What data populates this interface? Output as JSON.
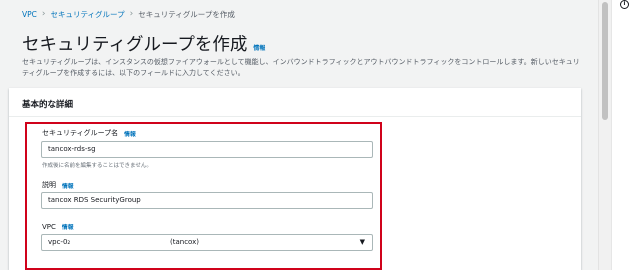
{
  "breadcrumb": {
    "items": [
      "VPC",
      "セキュリティグループ"
    ],
    "separator": "›",
    "current": "セキュリティグループを作成"
  },
  "page": {
    "title": "セキュリティグループを作成",
    "info": "情報",
    "description": "セキュリティグループは、インスタンスの仮想ファイアウォールとして機能し、インバウンドトラフィックとアウトバウンドトラフィックをコントロールします。新しいセキュリティグループを作成するには、以下のフィールドに入力してください。"
  },
  "panel": {
    "title": "基本的な詳細",
    "fields": {
      "name": {
        "label": "セキュリティグループ名",
        "info": "情報",
        "value": "tancox-rds-sg",
        "hint": "作成後に名前を編集することはできません。"
      },
      "description": {
        "label": "説明",
        "info": "情報",
        "value": "tancox RDS SecurityGroup"
      },
      "vpc": {
        "label": "VPC",
        "info": "情報",
        "value_prefix": "vpc-0₂",
        "value_suffix": "(tancox)"
      }
    }
  },
  "icons": {
    "caret": "▼",
    "info_circle": "i"
  },
  "colors": {
    "link": "#0073bb",
    "highlight": "#d0021b"
  }
}
